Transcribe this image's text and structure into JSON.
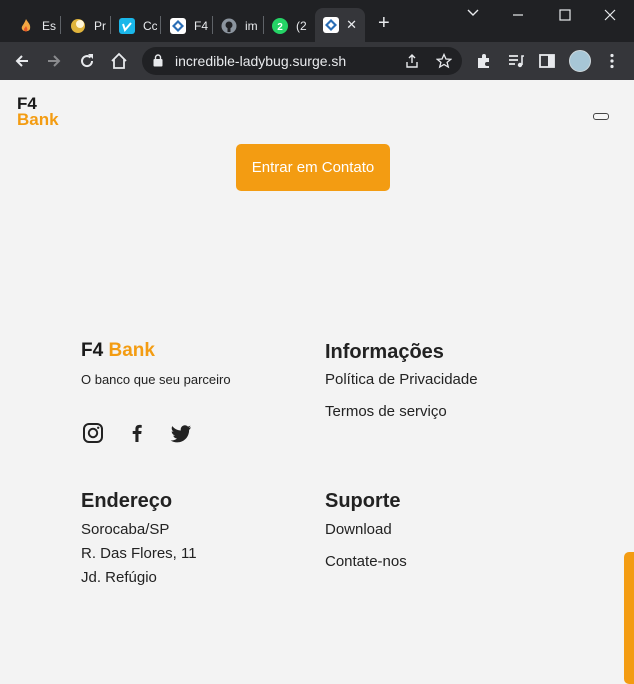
{
  "browser": {
    "tabs": [
      {
        "label": "Es"
      },
      {
        "label": "Pr"
      },
      {
        "label": "Cc"
      },
      {
        "label": "F4"
      },
      {
        "label": "im"
      },
      {
        "label": "(2"
      },
      {
        "label": ""
      }
    ],
    "url": "incredible-ladybug.surge.sh"
  },
  "header": {
    "logo_line1": "F4",
    "logo_line2": "Bank"
  },
  "cta": {
    "label": "Entrar em Contato"
  },
  "footer": {
    "brand_part1": "F4",
    "brand_part2": "Bank",
    "tagline": "O banco que seu parceiro",
    "social": [
      "instagram-icon",
      "facebook-icon",
      "twitter-icon"
    ],
    "info": {
      "title": "Informações",
      "links": [
        "Política de Privacidade",
        "Termos de serviço"
      ]
    },
    "address": {
      "title": "Endereço",
      "lines": [
        "Sorocaba/SP",
        "R. Das Flores, 11",
        "Jd. Refúgio"
      ]
    },
    "support": {
      "title": "Suporte",
      "links": [
        "Download",
        "Contate-nos"
      ]
    }
  },
  "colors": {
    "accent": "#f39c12",
    "background": "#f3f3f3",
    "text": "#222222"
  }
}
